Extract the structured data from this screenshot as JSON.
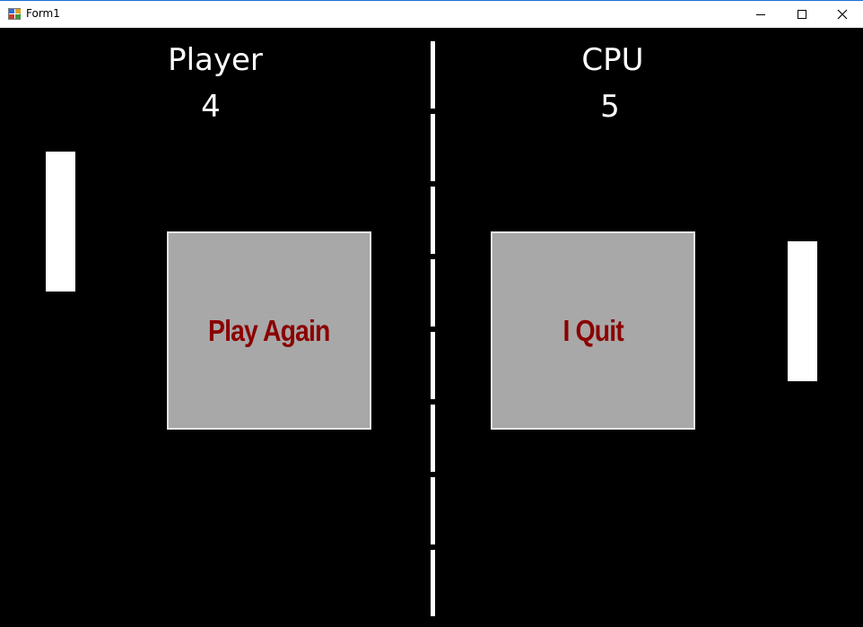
{
  "window": {
    "title": "Form1",
    "icon": "winforms-app-icon",
    "controls": [
      "minimize-icon",
      "maximize-icon",
      "close-icon"
    ]
  },
  "scoreboard": {
    "player_label": "Player",
    "player_score": "4",
    "cpu_label": "CPU",
    "cpu_score": "5"
  },
  "buttons": {
    "play_again": "Play Again",
    "quit": "I Quit"
  },
  "colors": {
    "background": "#000000",
    "foreground": "#ffffff",
    "button_face": "#a8a8a8",
    "button_text": "#8b0000"
  }
}
